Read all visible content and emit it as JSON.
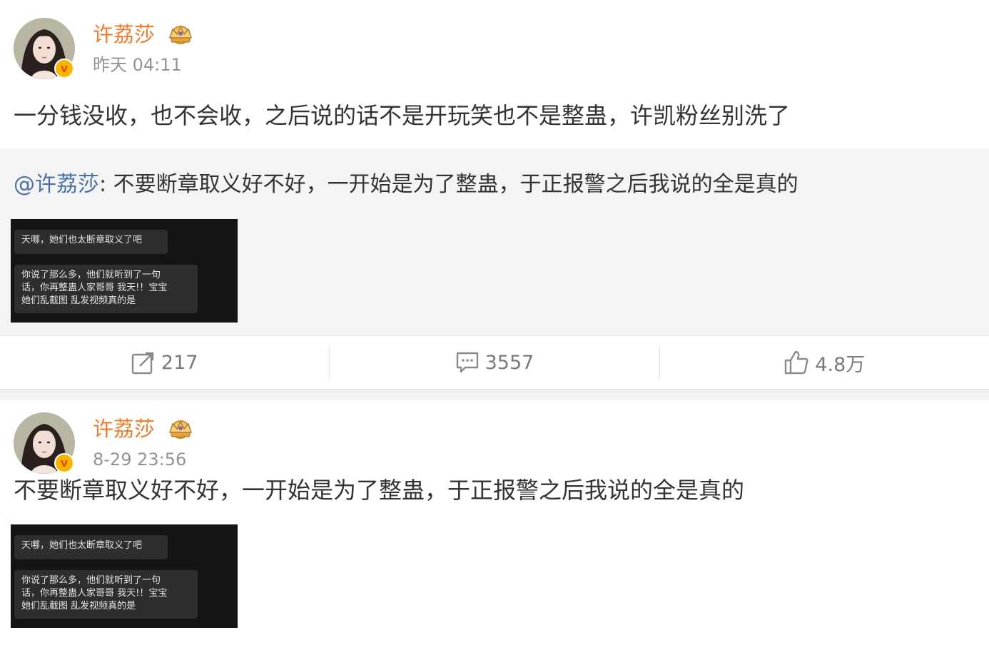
{
  "posts": [
    {
      "username": "许荔莎",
      "time": "昨天 04:11",
      "text": "一分钱没收，也不会收，之后说的话不是开玩笑也不是整蛊，许凯粉丝别洗了",
      "repost": {
        "mention": "@许荔莎",
        "separator": ":",
        "text": " 不要断章取义好不好，一开始是为了整蛊，于正报警之后我说的全是真的",
        "image": {
          "bubble1": "天哪，她们也太断章取义了吧",
          "bubble2_line1": "你说了那么多，他们就听到了一句",
          "bubble2_line2": "话，你再整蛊人家哥哥 我天!！宝宝",
          "bubble2_line3": "她们乱截图 乱发视频真的是"
        }
      },
      "actions": {
        "repost_count": "217",
        "comment_count": "3557",
        "like_count": "4.8万"
      }
    },
    {
      "username": "许荔莎",
      "time": "8-29 23:56",
      "text": "不要断章取义好不好，一开始是为了整蛊，于正报警之后我说的全是真的",
      "image": {
        "bubble1": "天哪，她们也太断章取义了吧",
        "bubble2_line1": "你说了那么多，他们就听到了一句",
        "bubble2_line2": "话，你再整蛊人家哥哥 我天!！宝宝",
        "bubble2_line3": "她们乱截图 乱发视频真的是"
      }
    }
  ],
  "icons": {
    "verified": "verified-v-badge",
    "crown": "crown-icon",
    "repost": "repost-icon",
    "comment": "comment-icon",
    "like": "thumbs-up-icon"
  },
  "colors": {
    "username": "#f07c2a",
    "mention": "#4a70a7",
    "timestamp": "#939393",
    "verified_badge": "#f7b500"
  }
}
